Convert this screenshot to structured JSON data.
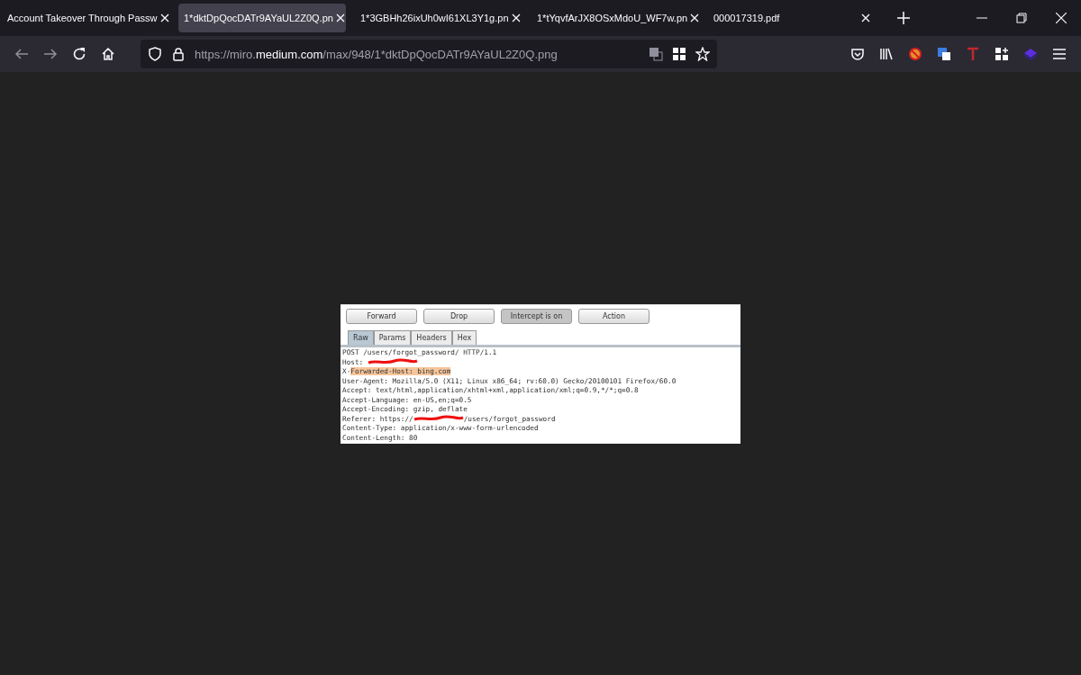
{
  "tabs": [
    {
      "title": "Account Takeover Through Passw",
      "selected": false
    },
    {
      "title": "1*dktDpQocDATr9AYaUL2Z0Q.pn",
      "selected": true
    },
    {
      "title": "1*3GBHh26ixUh0wI61XL3Y1g.pn",
      "selected": false
    },
    {
      "title": "1*tYqvfArJX8OSxMdoU_WF7w.pn",
      "selected": false
    },
    {
      "title": "000017319.pdf",
      "selected": false
    }
  ],
  "url": "https://miro.**medium.com**/max/948/1*dktDpQocDATr9AYaUL2Z0Q.png",
  "burp": {
    "buttons": [
      {
        "label": "Forward",
        "selected": false
      },
      {
        "label": "Drop",
        "selected": false
      },
      {
        "label": "Intercept is on",
        "selected": true
      },
      {
        "label": "Action",
        "selected": false
      }
    ],
    "tabs": [
      {
        "label": "Raw",
        "selected": true
      },
      {
        "label": "Params",
        "selected": false
      },
      {
        "label": "Headers",
        "selected": false
      },
      {
        "label": "Hex",
        "selected": false
      }
    ],
    "lines": [
      [
        {
          "kind": "plain",
          "text": "POST /users/forgot_password/ HTTP/1.1"
        }
      ],
      [
        {
          "kind": "plain",
          "text": "Host: "
        },
        {
          "kind": "redaction"
        }
      ],
      [
        {
          "kind": "plain",
          "text": "X-"
        },
        {
          "kind": "highlight",
          "text": "Forwarded-Host: bing.com"
        }
      ],
      [
        {
          "kind": "plain",
          "text": "User-Agent: Mozilla/5.0 (X11; Linux x86_64; rv:60.0) Gecko/20100101 Firefox/60.0"
        }
      ],
      [
        {
          "kind": "plain",
          "text": "Accept: text/html,application/xhtml+xml,application/xml;q=0.9,*/*;q=0.8"
        }
      ],
      [
        {
          "kind": "plain",
          "text": "Accept-Language: en-US,en;q=0.5"
        }
      ],
      [
        {
          "kind": "plain",
          "text": "Accept-Encoding: gzip, deflate"
        }
      ],
      [
        {
          "kind": "plain",
          "text": "Referer: https://"
        },
        {
          "kind": "redaction"
        },
        {
          "kind": "plain",
          "text": "/users/forgot_password"
        }
      ],
      [
        {
          "kind": "plain",
          "text": "Content-Type: application/x-www-form-urlencoded"
        }
      ],
      [
        {
          "kind": "plain",
          "text": "Content-Length: 80"
        }
      ]
    ]
  }
}
